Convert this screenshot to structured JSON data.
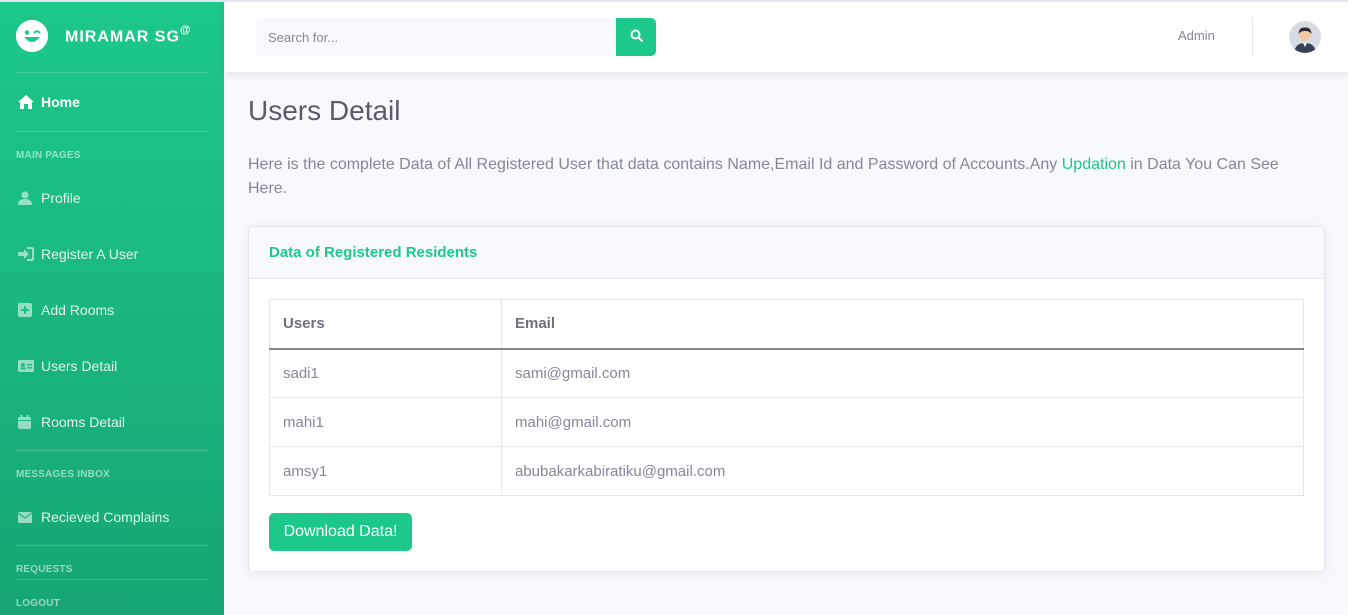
{
  "brand": {
    "name": "MIRAMAR SG",
    "sup": "@"
  },
  "sidebar": {
    "home": "Home",
    "headings": [
      "MAIN PAGES",
      "MESSAGES INBOX",
      "REQUESTS",
      "LOGOUT"
    ],
    "items": [
      {
        "label": "Profile",
        "icon": "user-icon"
      },
      {
        "label": "Register A User",
        "icon": "sign-in-icon"
      },
      {
        "label": "Add Rooms",
        "icon": "plus-square-icon"
      },
      {
        "label": "Users Detail",
        "icon": "id-card-icon"
      },
      {
        "label": "Rooms Detail",
        "icon": "calendar-icon"
      },
      {
        "label": "Recieved Complains",
        "icon": "envelope-icon"
      }
    ]
  },
  "topbar": {
    "search_placeholder": "Search for...",
    "user_name": "Admin"
  },
  "main": {
    "title": "Users Detail",
    "intro_before": "Here is the complete Data of All Registered User that data contains Name,Email Id and Password of Accounts.Any ",
    "intro_highlight": "Updation",
    "intro_after": " in Data You Can See Here.",
    "card_title": "Data of Registered Residents",
    "table": {
      "headers": [
        "Users",
        "Email"
      ],
      "rows": [
        [
          "sadi1",
          "sami@gmail.com"
        ],
        [
          "mahi1",
          "mahi@gmail.com"
        ],
        [
          "amsy1",
          "abubakarkabiratiku@gmail.com"
        ]
      ]
    },
    "download_label": "Download Data!"
  },
  "colors": {
    "accent": "#1cc88a",
    "accent_dark": "#17a673",
    "text": "#858796",
    "heading": "#5a5c69"
  }
}
